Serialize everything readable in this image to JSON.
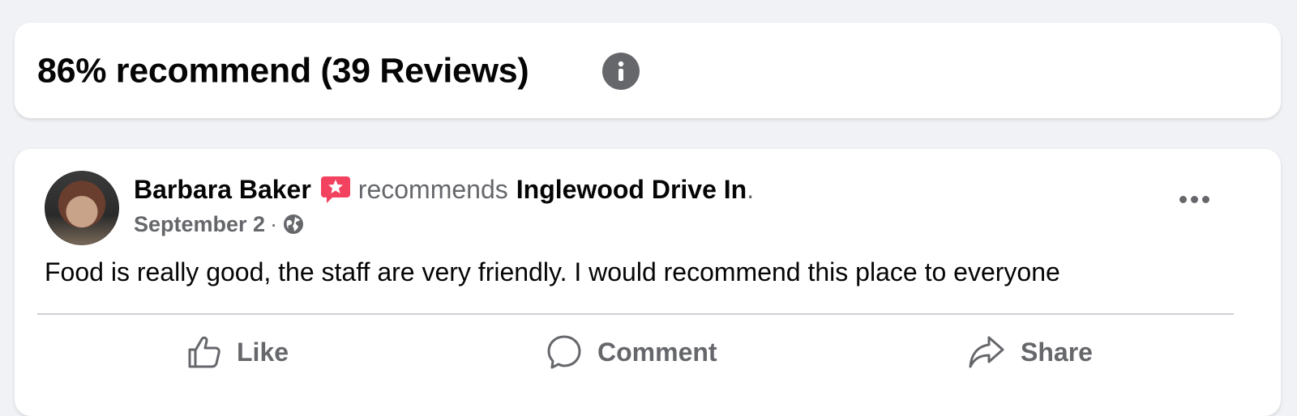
{
  "summary": {
    "title": "86% recommend (39 Reviews)",
    "info_icon": "info-icon"
  },
  "review": {
    "author": "Barbara Baker",
    "recommend_icon": "recommend-badge-icon",
    "verb": "recommends",
    "page": "Inglewood Drive In",
    "period": ".",
    "date": "September 2",
    "separator": "·",
    "privacy_icon": "globe-icon",
    "more_icon": "more-options-icon",
    "text": "Food is really good, the staff are very friendly. I would recommend this place to everyone"
  },
  "actions": {
    "like": "Like",
    "comment": "Comment",
    "share": "Share"
  },
  "colors": {
    "background": "#f0f2f5",
    "card": "#ffffff",
    "secondary_text": "#65676b",
    "recommend_badge": "#f3425f",
    "divider": "#ced0d4"
  }
}
